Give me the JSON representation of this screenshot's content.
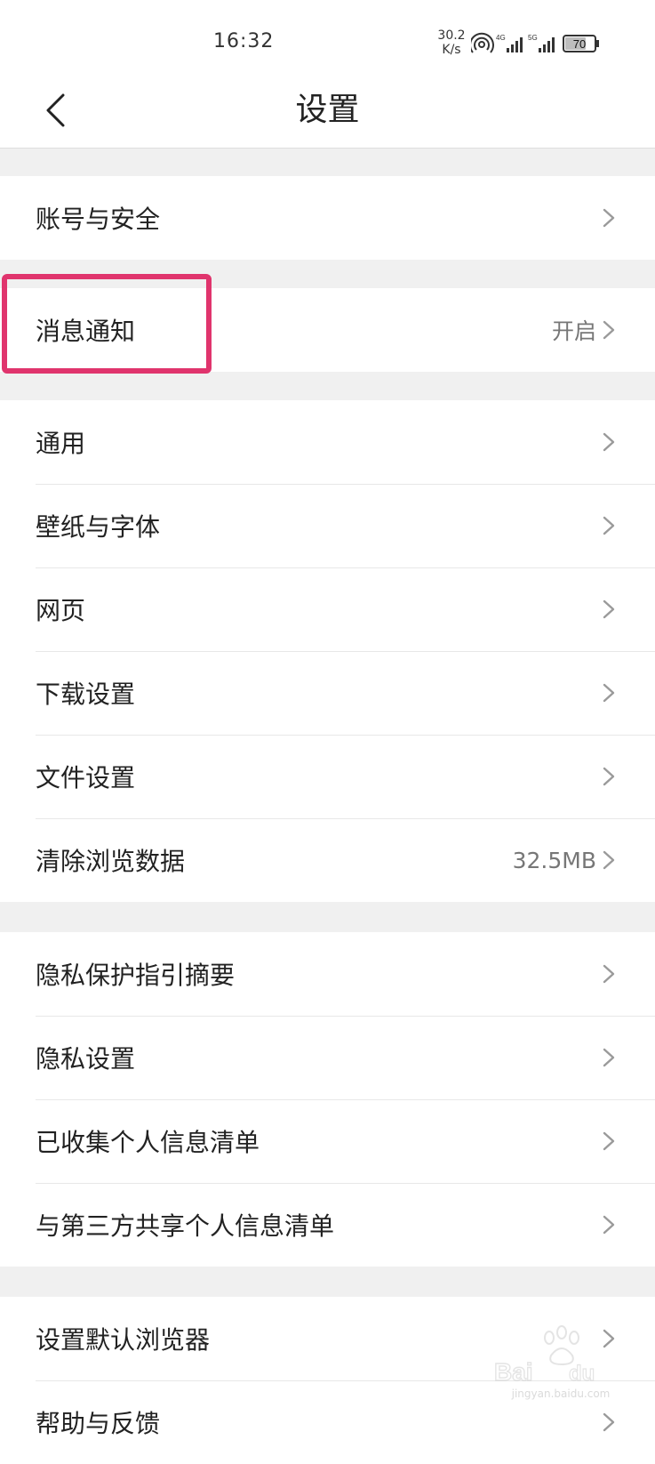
{
  "status_bar": {
    "time": "16:32",
    "net_speed_value": "30.2",
    "net_speed_unit": "K/s",
    "signal_1_label": "4G",
    "signal_2_label": "5G",
    "battery": "70"
  },
  "header": {
    "title": "设置",
    "back_icon": "chevron-left-icon"
  },
  "groups": [
    {
      "items": [
        {
          "label": "账号与安全",
          "value": ""
        }
      ]
    },
    {
      "items": [
        {
          "label": "消息通知",
          "value": "开启"
        }
      ]
    },
    {
      "items": [
        {
          "label": "通用",
          "value": ""
        },
        {
          "label": "壁纸与字体",
          "value": ""
        },
        {
          "label": "网页",
          "value": ""
        },
        {
          "label": "下载设置",
          "value": ""
        },
        {
          "label": "文件设置",
          "value": ""
        },
        {
          "label": "清除浏览数据",
          "value": "32.5MB"
        }
      ]
    },
    {
      "items": [
        {
          "label": "隐私保护指引摘要",
          "value": ""
        },
        {
          "label": "隐私设置",
          "value": ""
        },
        {
          "label": "已收集个人信息清单",
          "value": ""
        },
        {
          "label": "与第三方共享个人信息清单",
          "value": ""
        }
      ]
    },
    {
      "items": [
        {
          "label": "设置默认浏览器",
          "value": ""
        },
        {
          "label": "帮助与反馈",
          "value": ""
        }
      ]
    }
  ],
  "colors": {
    "highlight": "#e0346d",
    "background": "#f0f0f0",
    "card": "#ffffff",
    "chevron": "#9a9a9a"
  },
  "watermark": {
    "logo": "baidu-jingyan-logo",
    "text": "jingyan.baidu.com"
  }
}
